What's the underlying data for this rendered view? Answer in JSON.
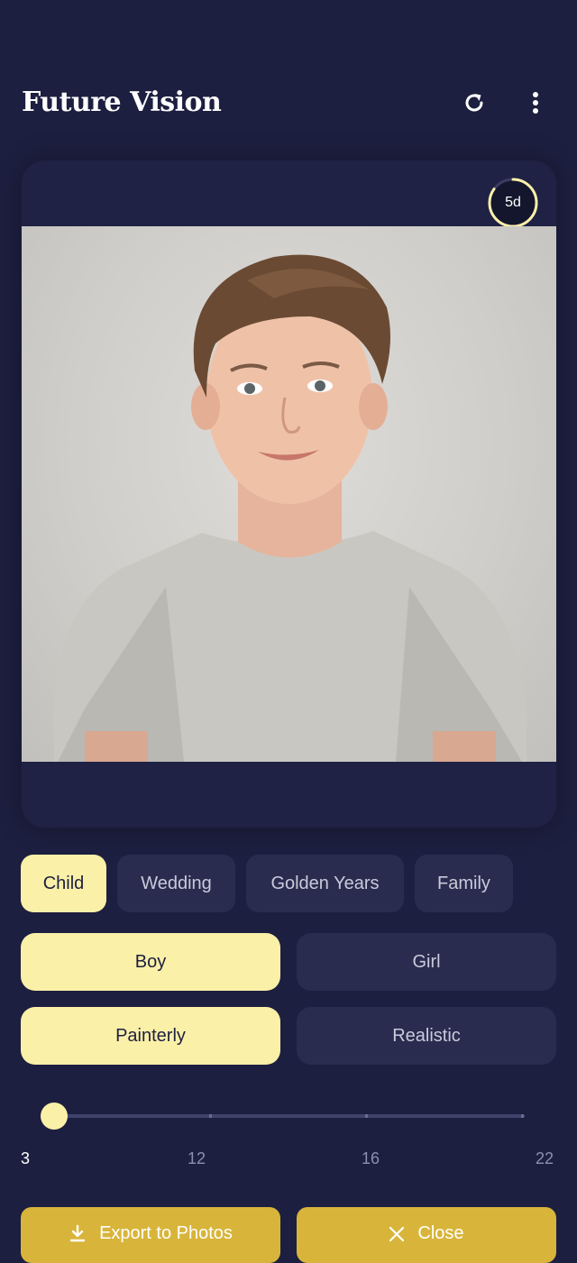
{
  "header": {
    "title": "Future Vision",
    "refresh_icon": "refresh-icon",
    "more_icon": "more-vertical-icon"
  },
  "preview": {
    "badge": "5d",
    "badge_progress": 0.85,
    "image_alt": "Portrait of a smiling boy in a white t-shirt"
  },
  "categories": [
    {
      "label": "Child",
      "active": true
    },
    {
      "label": "Wedding",
      "active": false
    },
    {
      "label": "Golden Years",
      "active": false
    },
    {
      "label": "Family",
      "active": false
    }
  ],
  "gender": {
    "options": [
      "Boy",
      "Girl"
    ],
    "selected": "Boy"
  },
  "style": {
    "options": [
      "Painterly",
      "Realistic"
    ],
    "selected": "Painterly"
  },
  "age_slider": {
    "value": 3,
    "ticks": [
      "3",
      "12",
      "16",
      "22"
    ]
  },
  "actions": {
    "export_label": "Export to Photos",
    "export_icon": "download-icon",
    "close_label": "Close",
    "close_icon": "close-icon"
  },
  "colors": {
    "background": "#1d1f40",
    "accent": "#fbf0a8",
    "action": "#d8b53a"
  }
}
